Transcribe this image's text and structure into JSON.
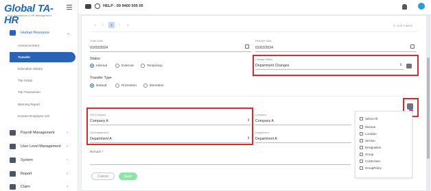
{
  "app": {
    "logo_text": "Global TA-HR",
    "logo_tagline": "Time Attendance & HR Management",
    "help_text": "HELP : 09 9400 505 00"
  },
  "sidebar": {
    "sections": [
      {
        "label": "Human Resource",
        "icon": "people-icon",
        "expanded": true
      },
      {
        "label": "Payroll Management",
        "icon": "payroll-icon"
      },
      {
        "label": "User Level Management",
        "icon": "users-icon"
      },
      {
        "label": "System",
        "icon": "sliders-icon"
      },
      {
        "label": "Report",
        "icon": "report-icon"
      },
      {
        "label": "Claim",
        "icon": "claim-icon"
      }
    ],
    "sub_items": [
      {
        "label": "Announcement"
      },
      {
        "label": "Transfer",
        "active": true
      },
      {
        "label": "Education History"
      },
      {
        "label": "Trip Setup"
      },
      {
        "label": "Trip Transaction"
      },
      {
        "label": "Warning Report"
      },
      {
        "label": "Contact Employee List"
      }
    ]
  },
  "pager": {
    "pages": [
      "«",
      "‹",
      "1",
      "›",
      "»"
    ],
    "current": "1",
    "info": "1 - 1 of 1 items"
  },
  "form": {
    "order_date": {
      "label": "Order Date",
      "value": "01/02/2024"
    },
    "effective_date": {
      "label": "Effective Date",
      "value": "01/02/2024"
    },
    "status": {
      "label": "Status",
      "options": [
        "Internal",
        "External",
        "Temporary"
      ],
      "selected": "Internal"
    },
    "change_status": {
      "label": "Change Status",
      "value": "Department Changes"
    },
    "transfer_type": {
      "label": "Transfer Type",
      "options": [
        "Default",
        "Promotion",
        "Demotion"
      ],
      "selected": "Default"
    },
    "old_company": {
      "label": "Old Company",
      "value": "Company A"
    },
    "company": {
      "label": "Company",
      "value": "Company A"
    },
    "old_department": {
      "label": "Old Department",
      "value": "Department A"
    },
    "department": {
      "label": "Department",
      "value": "Department A"
    },
    "remark": {
      "label": "Remark",
      "required_mark": "*"
    }
  },
  "columns_panel": {
    "items": [
      "Select All",
      "Division",
      "Location",
      "Section",
      "Designation",
      "Group",
      "CostCenter",
      "GroupPolicy"
    ]
  },
  "buttons": {
    "cancel": "Cancel",
    "save": "Save"
  },
  "colors": {
    "primary": "#2a63b6",
    "highlight": "#e0262f",
    "save_button": "#8fe3a7"
  }
}
